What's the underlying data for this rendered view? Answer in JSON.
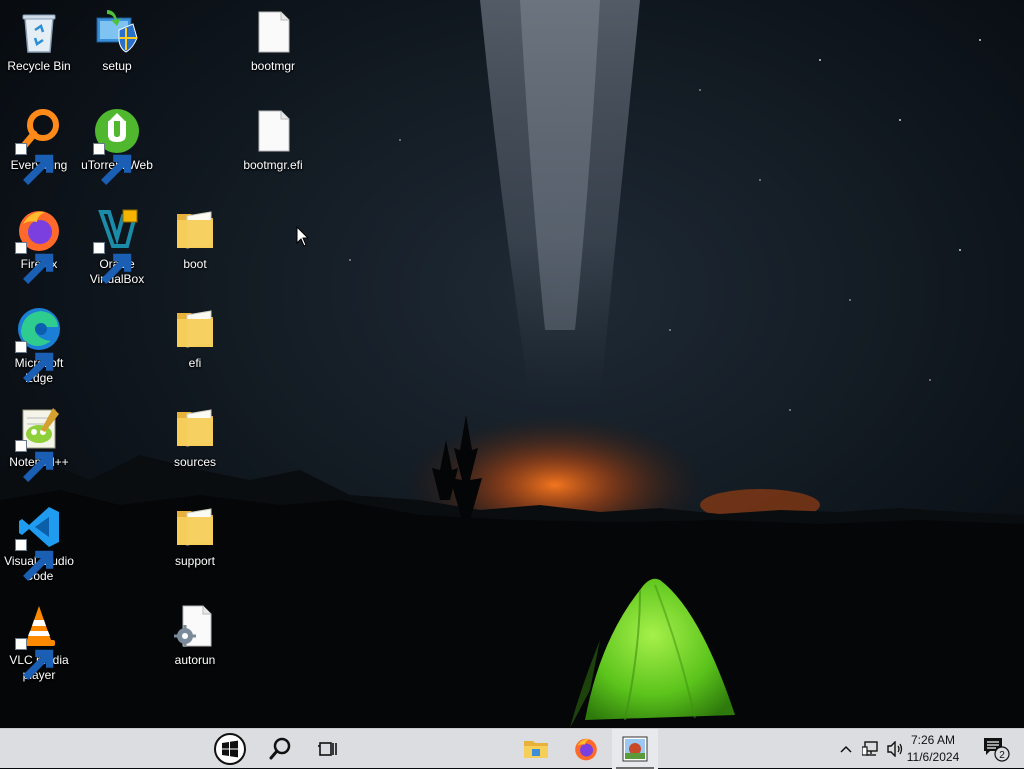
{
  "desktop": {
    "icons": [
      {
        "id": "recycle-bin",
        "label": "Recycle Bin"
      },
      {
        "id": "setup",
        "label": "setup"
      },
      {
        "id": "bootmgr",
        "label": "bootmgr"
      },
      {
        "id": "everything",
        "label": "Everything"
      },
      {
        "id": "utorrent-web",
        "label": "uTorrent Web"
      },
      {
        "id": "bootmgr-efi",
        "label": "bootmgr.efi"
      },
      {
        "id": "firefox",
        "label": "Firefox"
      },
      {
        "id": "oracle-virtualbox",
        "label": "Oracle VirtualBox"
      },
      {
        "id": "boot",
        "label": "boot"
      },
      {
        "id": "microsoft-edge",
        "label": "Microsoft Edge"
      },
      {
        "id": "efi",
        "label": "efi"
      },
      {
        "id": "notepad-plus-plus",
        "label": "Notepad++"
      },
      {
        "id": "sources",
        "label": "sources"
      },
      {
        "id": "visual-studio-code",
        "label": "Visual Studio Code"
      },
      {
        "id": "support",
        "label": "support"
      },
      {
        "id": "vlc-media-player",
        "label": "VLC media player"
      },
      {
        "id": "autorun",
        "label": "autorun"
      }
    ]
  },
  "taskbar": {
    "start_icon": "windows-start-icon",
    "search_icon": "search-icon",
    "taskview_icon": "task-view-icon",
    "pinned": [
      "file-explorer-icon",
      "firefox-icon",
      "paint-app-icon"
    ],
    "tray": {
      "time": "7:26 AM",
      "date": "11/6/2024",
      "notification_count": "2"
    }
  },
  "colors": {
    "taskbar_bg": "#dcdde0",
    "folder_yellow": "#f5c84c",
    "tent_green": "#6fd224"
  }
}
